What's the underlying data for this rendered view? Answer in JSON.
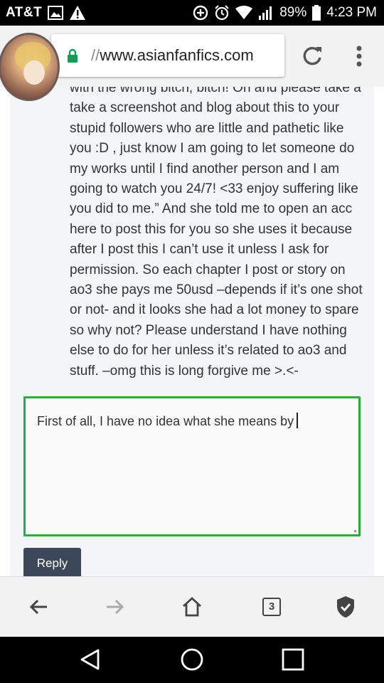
{
  "status_bar": {
    "carrier": "AT&T",
    "battery": "89%",
    "time": "4:23 PM",
    "icons": [
      "image-icon",
      "warning-icon",
      "data-saver-icon",
      "alarm-icon",
      "wifi-icon",
      "signal-icon",
      "battery-icon"
    ]
  },
  "browser": {
    "url_scheme": "//",
    "url_host": "www.asianfanfics.com",
    "accent_color": "#2eaa3e"
  },
  "comment": {
    "lines": [
      "with the wrong bitch, bitch! Oh and please take a",
      "take a screenshot and blog about this to your",
      "stupid followers who are little and pathetic like",
      "you :D , just know I am going to let someone do",
      "my works until I find another person and I am",
      "going to watch you 24/7! <33 enjoy suffering like",
      "you did to me.” And she told me to open an acc",
      "here to post this for you so she uses it because",
      "after I post this I can’t use it unless I ask for",
      "permission. So each chapter I post or story on",
      "ao3 she pays me 50usd –depends if it’s one shot",
      "or not- and it looks she had a lot money to spare",
      "so why not? Please understand I have nothing",
      "else to do for her unless it’s related to ao3 and",
      "stuff. –omg this is long forgive me >.<-"
    ]
  },
  "reply": {
    "text": "First of all, I have no idea what she means by",
    "button_label": "Reply",
    "button_color": "#3c4758"
  },
  "toolbar": {
    "tab_count": "3"
  }
}
